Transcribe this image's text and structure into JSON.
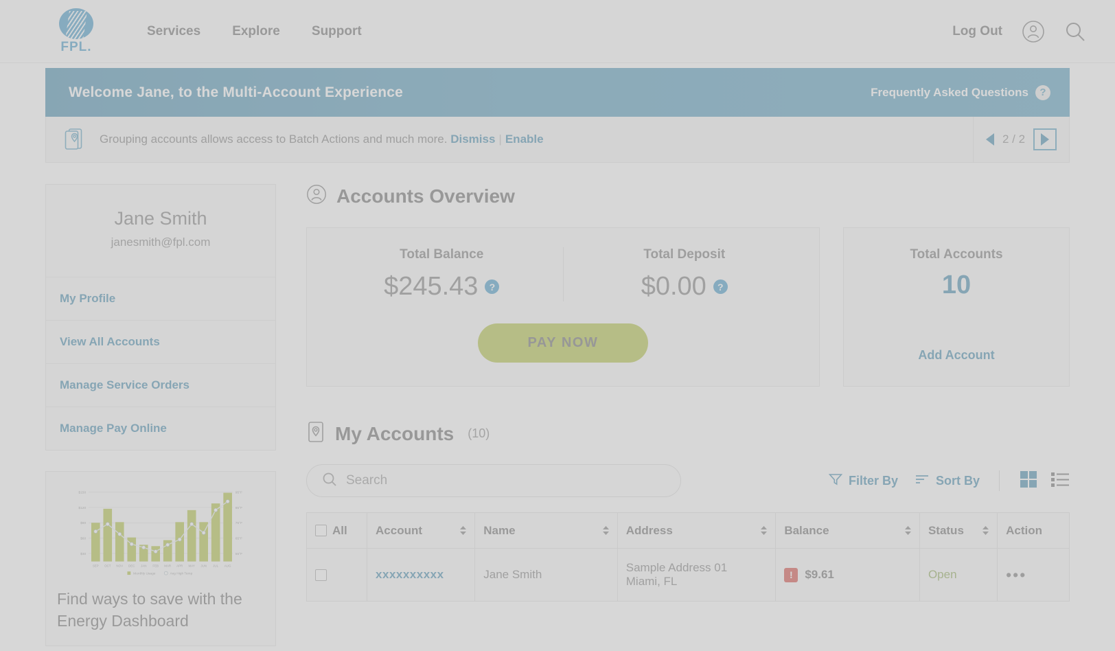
{
  "header": {
    "logo_text": "FPL.",
    "nav": [
      {
        "label": "Services"
      },
      {
        "label": "Explore"
      },
      {
        "label": "Support"
      }
    ],
    "logout_label": "Log Out",
    "account_icon": "user-circle-icon",
    "search_icon": "search-icon"
  },
  "welcome_banner": {
    "text": "Welcome Jane, to the Multi-Account Experience",
    "faq_label": "Frequently Asked Questions",
    "faq_icon": "question-mark-icon"
  },
  "notice": {
    "icon": "stacked-location-pin-icon",
    "message": "Grouping accounts allows access to Batch Actions and much more.",
    "dismiss_label": "Dismiss",
    "separator": "|",
    "enable_label": "Enable",
    "page_indicator": "2 / 2",
    "prev_icon": "triangle-left-icon",
    "next_icon": "triangle-right-icon"
  },
  "sidebar": {
    "profile": {
      "name": "Jane Smith",
      "email": "janesmith@fpl.com"
    },
    "links": [
      {
        "label": "My Profile"
      },
      {
        "label": "View All Accounts"
      },
      {
        "label": "Manage Service Orders"
      },
      {
        "label": "Manage Pay Online"
      }
    ],
    "promo": {
      "title": "Find ways to save with the Energy Dashboard"
    }
  },
  "overview": {
    "title": "Accounts Overview",
    "title_icon": "user-circle-icon",
    "total_balance_label": "Total Balance",
    "total_balance_value": "$245.43",
    "total_deposit_label": "Total Deposit",
    "total_deposit_value": "$0.00",
    "info_icon": "question-mark-icon",
    "pay_now_label": "PAY NOW",
    "total_accounts_label": "Total Accounts",
    "total_accounts_value": "10",
    "add_account_label": "Add Account"
  },
  "my_accounts": {
    "title": "My Accounts",
    "title_icon": "location-pin-card-icon",
    "count_label": "(10)",
    "search_placeholder": "Search",
    "search_value": "",
    "search_icon": "search-icon",
    "filter_label": "Filter By",
    "filter_icon": "funnel-icon",
    "sort_label": "Sort By",
    "sort_icon": "sort-lines-icon",
    "grid_view_icon": "grid-view-icon",
    "list_view_icon": "list-view-icon",
    "columns": [
      {
        "label": "All",
        "sortable": false
      },
      {
        "label": "Account",
        "sortable": true
      },
      {
        "label": "Name",
        "sortable": true
      },
      {
        "label": "Address",
        "sortable": true
      },
      {
        "label": "Balance",
        "sortable": true
      },
      {
        "label": "Status",
        "sortable": true
      },
      {
        "label": "Action",
        "sortable": false
      }
    ],
    "rows": [
      {
        "account": "xxxxxxxxxx",
        "name": "Jane Smith",
        "address_line1": "Sample Address 01",
        "address_line2": "Miami, FL",
        "balance": "$9.61",
        "balance_alert": "!",
        "status": "Open",
        "action": "•••"
      }
    ]
  },
  "colors": {
    "brand_blue": "#2a8bc0",
    "link_blue": "#2a7ba3",
    "banner_blue": "#3f90b5",
    "accent_green": "#a9ba2c",
    "alert_red": "#d0342c",
    "status_green": "#7f9e3f"
  },
  "chart_data": {
    "type": "bar",
    "title": "",
    "categories": [
      "SEP",
      "OCT",
      "NOV",
      "DEC",
      "JAN",
      "FEB",
      "MAR",
      "APR",
      "MAY",
      "JUN",
      "JUL",
      "AUG"
    ],
    "series": [
      {
        "name": "Monthly Usage",
        "type": "bar",
        "color": "#a9ba2c",
        "values": [
          90,
          118,
          92,
          62,
          48,
          45,
          58,
          92,
          112,
          93,
          128,
          148
        ]
      },
      {
        "name": "Avg High Temp",
        "type": "line",
        "color": "#d9e3e8",
        "values": [
          72,
          76,
          70,
          62,
          60,
          57,
          62,
          66,
          76,
          69,
          82,
          88
        ]
      }
    ],
    "ylabel": "",
    "ytick_labels": [
      "$30",
      "$60",
      "$90",
      "$120",
      "$150"
    ],
    "y2tick_labels": [
      "55°F",
      "65°F",
      "75°F",
      "85°F",
      "95°F"
    ],
    "ylim": [
      0,
      160
    ],
    "y2lim": [
      50,
      95
    ],
    "grid": true,
    "legend": [
      "Monthly Usage",
      "Avg High Temp"
    ],
    "legend_position": "bottom"
  }
}
